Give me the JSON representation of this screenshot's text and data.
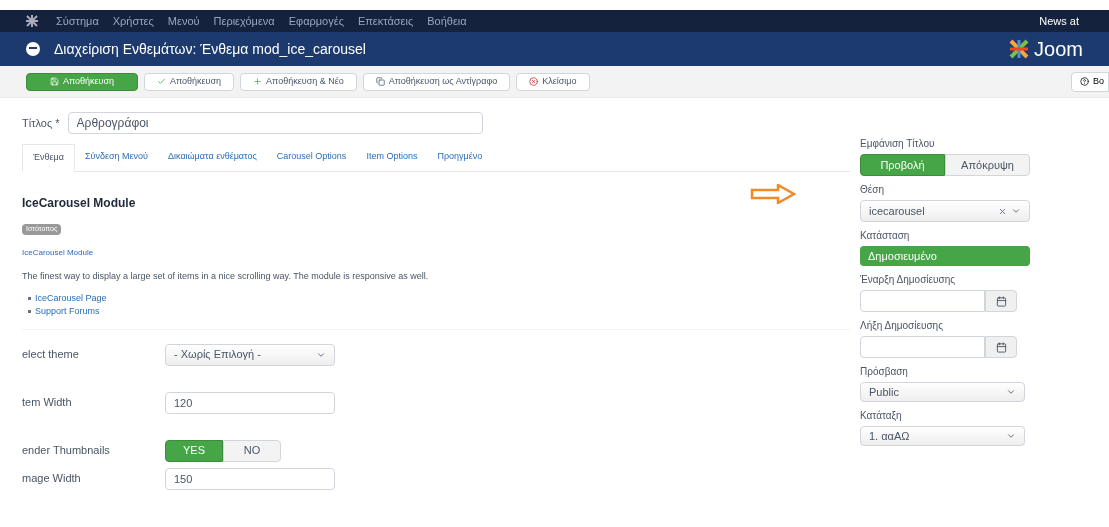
{
  "menu": {
    "items": [
      "Σύστημα",
      "Χρήστες",
      "Μενού",
      "Περιεχόμενα",
      "Εφαρμογές",
      "Επεκτάσεις",
      "Βοήθεια"
    ],
    "user": "News at"
  },
  "header": {
    "title": "Διαχείριση Ενθεμάτων: Ένθεμα mod_ice_carousel",
    "logo": "Joom"
  },
  "toolbar": {
    "buttons": [
      {
        "label": "Αποθήκευση",
        "kind": "primary"
      },
      {
        "label": "Αποθήκευση",
        "kind": "check"
      },
      {
        "label": "Αποθήκευση & Νέο",
        "kind": "plus"
      },
      {
        "label": "Αποθήκευση ως Αντίγραφο",
        "kind": "copy"
      },
      {
        "label": "Κλείσιμο",
        "kind": "close"
      }
    ],
    "help": "Βο"
  },
  "title_field": {
    "label": "Τίτλος *",
    "value": "Αρθρογράφοι"
  },
  "tabs": [
    {
      "label": "Ένθεμα",
      "selected": true
    },
    {
      "label": "Σύνδεση Μενού",
      "selected": false
    },
    {
      "label": "Δικαιώματα ενθέματος",
      "selected": false
    },
    {
      "label": "Carousel Options",
      "selected": false
    },
    {
      "label": "Item Options",
      "selected": false
    },
    {
      "label": "Προηγμένο",
      "selected": false
    }
  ],
  "module": {
    "heading": "IceCarousel Module",
    "badge": "Ιστότοπος",
    "link": "IceCarousel Module",
    "description": "The finest way to display a large set of items in a nice scrolling way. The module is responsive as well.",
    "links": [
      "IceCarousel Page",
      "Support Forums"
    ]
  },
  "fields": [
    {
      "kind": "select",
      "label": "elect theme",
      "value": "- Χωρίς Επιλογή -"
    },
    {
      "kind": "text",
      "label": "tem Width",
      "value": "120"
    },
    {
      "kind": "toggle",
      "label": "ender Thumbnails",
      "options": [
        {
          "label": "YES",
          "selected": true
        },
        {
          "label": "NO",
          "selected": false
        }
      ]
    },
    {
      "kind": "text",
      "label": "mage Width",
      "value": "150"
    }
  ],
  "sidebar": [
    {
      "kind": "toggle",
      "label": "Εμφάνιση Τίτλου",
      "options": [
        {
          "label": "Προβολή",
          "selected": true
        },
        {
          "label": "Απόκρυψη",
          "selected": false
        }
      ]
    },
    {
      "kind": "chosen",
      "label": "Θέση",
      "value": "icecarousel"
    },
    {
      "kind": "status",
      "label": "Κατάσταση",
      "value": "Δημοσιευμένο"
    },
    {
      "kind": "date",
      "label": "Έναρξη Δημοσίευσης"
    },
    {
      "kind": "date",
      "label": "Λήξη Δημοσίευσης"
    },
    {
      "kind": "select",
      "label": "Πρόσβαση",
      "value": "Public"
    },
    {
      "kind": "select",
      "label": "Κατάταξη",
      "value": "1. ααΑΩ"
    }
  ]
}
